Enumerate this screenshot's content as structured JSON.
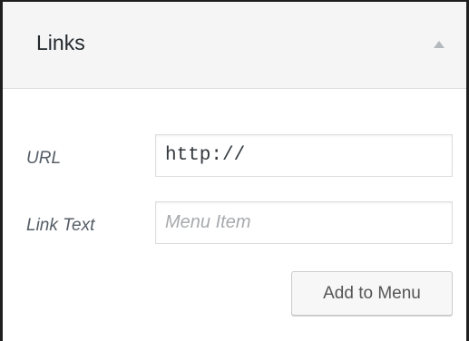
{
  "panel": {
    "title": "Links",
    "toggle_icon": "arrow-up-icon"
  },
  "form": {
    "url_label": "URL",
    "url_value": "http://",
    "link_text_label": "Link Text",
    "link_text_value": "",
    "link_text_placeholder": "Menu Item",
    "add_button_label": "Add to Menu"
  }
}
